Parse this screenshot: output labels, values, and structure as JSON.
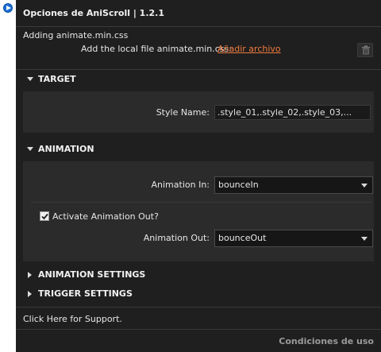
{
  "title": "Opciones de AniScroll | 1.2.1",
  "adding_text": "Adding animate.min.css",
  "add_file": {
    "label": "Add the local file animate.min.css:",
    "link": "Añadir archivo"
  },
  "target": {
    "heading": "TARGET",
    "style_name_label": "Style Name:",
    "style_name_value": ".style_01,.style_02,.style_03,..."
  },
  "animation": {
    "heading": "ANIMATION",
    "in_label": "Animation In:",
    "in_value": "bounceIn",
    "activate_out_label": "Activate Animation Out?",
    "activate_out_checked": true,
    "out_label": "Animation Out:",
    "out_value": "bounceOut"
  },
  "animation_settings": {
    "heading": "ANIMATION SETTINGS"
  },
  "trigger_settings": {
    "heading": "TRIGGER SETTINGS"
  },
  "support_text": "Click Here for Support.",
  "terms_text": "Condiciones de uso",
  "colors": {
    "panel_bg": "#1f1f1f",
    "section_bg": "#2b2b2b",
    "link": "#f07a3c",
    "info_icon": "#1a6fd6"
  },
  "icons": [
    "info-icon",
    "trash-icon",
    "triangle-down-icon",
    "triangle-right-icon",
    "checkmark-icon",
    "caret-down-icon"
  ]
}
